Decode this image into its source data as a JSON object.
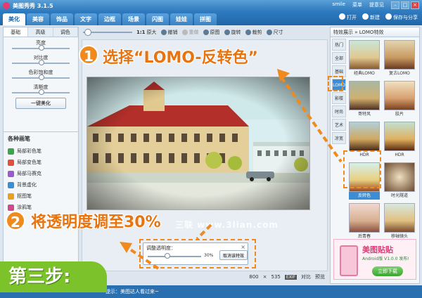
{
  "app": {
    "title": "美图秀秀 3.1.5",
    "user": "smile",
    "user_menu": "菜单",
    "feedback": "提意见"
  },
  "tabs": [
    "美化",
    "美容",
    "饰品",
    "文字",
    "边框",
    "场景",
    "闪图",
    "娃娃",
    "拼图"
  ],
  "file_actions": {
    "open": "打开",
    "new": "新建",
    "save_share": "保存与分享"
  },
  "left_panel": {
    "subtabs": [
      "基础",
      "高级",
      "调色"
    ],
    "sliders": [
      {
        "label": "亮度",
        "value": 0.5
      },
      {
        "label": "对比度",
        "value": 0.5
      },
      {
        "label": "色彩饱和度",
        "value": 0.5
      },
      {
        "label": "清晰度",
        "value": 0.5
      }
    ],
    "beautify_button": "一键美化",
    "brushes_header": "各种画笔",
    "brushes": [
      "局部彩色笔",
      "局部变色笔",
      "局部马赛克",
      "背景虚化",
      "抠图笔",
      "涂鸦笔"
    ]
  },
  "toolbar": {
    "ratio": "1:1",
    "original_size": "原大",
    "undo": "撤销",
    "redo": "重做",
    "original": "原图",
    "rotate": "旋转",
    "crop": "裁剪",
    "size": "尺寸"
  },
  "canvas": {
    "width": "800",
    "height": "535",
    "exif": "EXIF",
    "compare": "对比",
    "preview": "预览"
  },
  "opacity_box": {
    "label": "调整透明度：",
    "value": "30%",
    "percent": 30,
    "cancel": "取消该特效"
  },
  "right_panel": {
    "header": "特效展示 » LOMO特效",
    "categories": [
      "热门",
      "全部",
      "基础",
      "LOMO",
      "影楼",
      "时尚",
      "艺术",
      "凉宽"
    ],
    "selected_category": "LOMO",
    "effects": [
      "经典LOMO",
      "复古LOMO",
      "哥特风",
      "胶片",
      "HDR",
      "HDR",
      "反转色",
      "时光隧道",
      "后青春",
      "移轴镜头"
    ],
    "selected_effect": "反转色"
  },
  "ad": {
    "title": "美图贴贴",
    "subtitle": "Android版 V1.0.0 发布!",
    "download": "立即下载"
  },
  "status": {
    "tip": "提示：美图达人看过来~"
  },
  "watermark": "三联 www.3lian.com",
  "annotations": {
    "step1_number": "1",
    "step1_text": "选择“LOMO-反转色”",
    "step2_number": "2",
    "step2_text": "将透明度调至30%",
    "step3_text": "第三步:"
  },
  "colors": {
    "accent": "#f08a1c",
    "tab_blue": "#2f7bbf",
    "step_green": "#7cc22a"
  }
}
